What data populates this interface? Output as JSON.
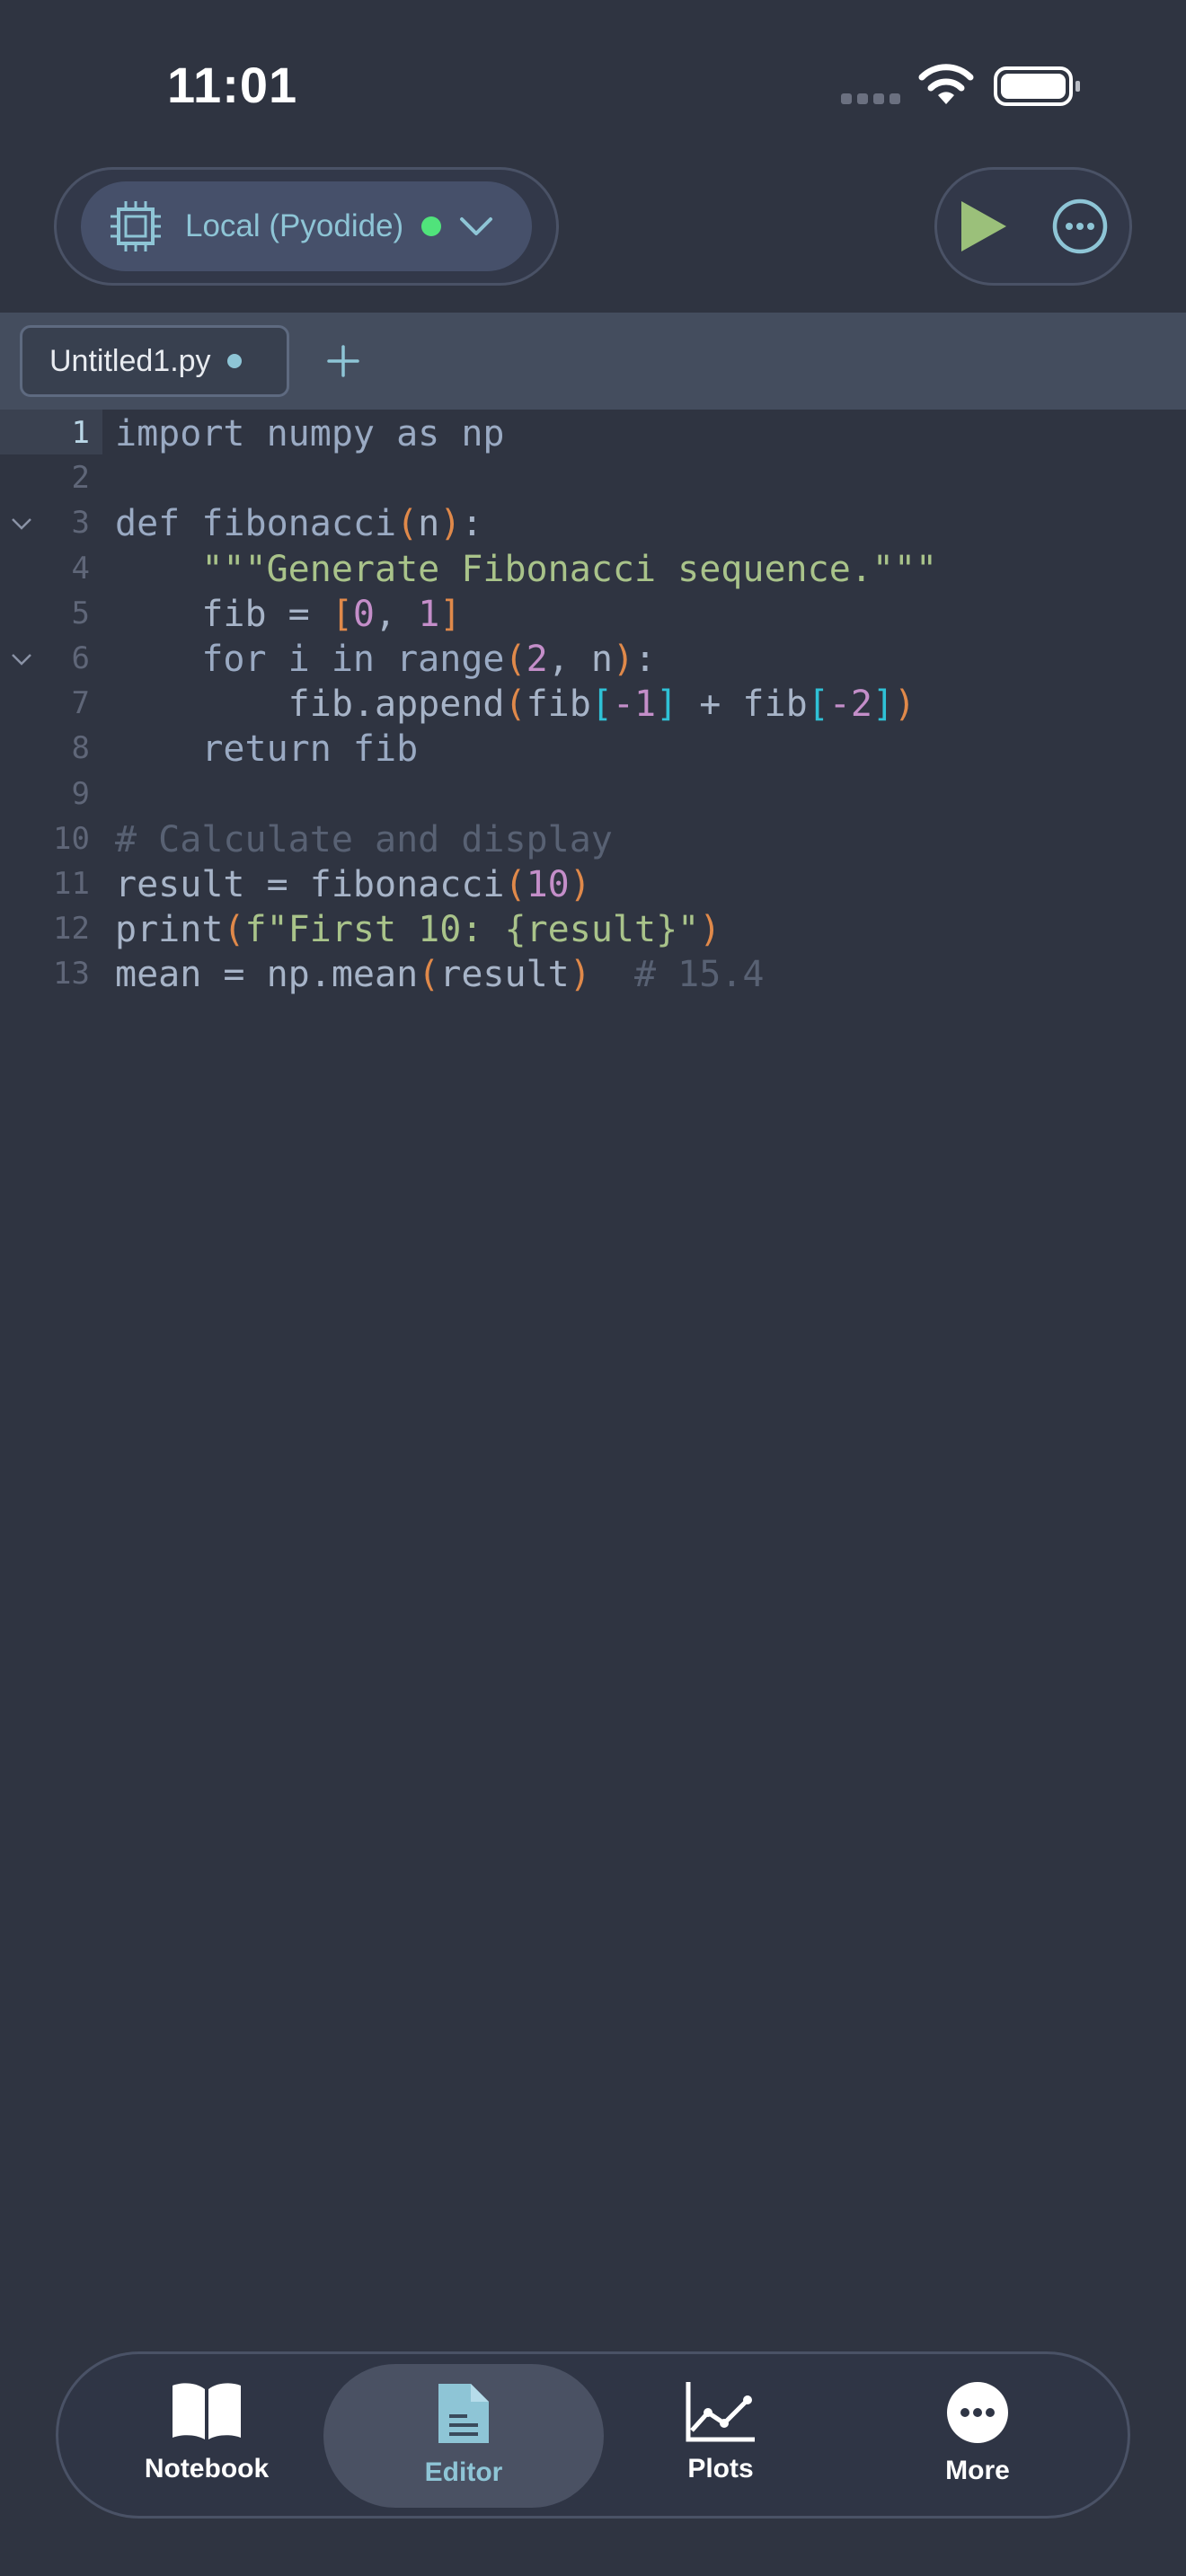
{
  "status_bar": {
    "time": "11:01"
  },
  "kernel": {
    "label": "Local (Pyodide)",
    "status_color": "#50e37b"
  },
  "toolbar": {
    "run_icon": "play-icon",
    "more_icon": "ellipsis-circle-icon"
  },
  "tabs": [
    {
      "label": "Untitled1.py",
      "modified": true
    }
  ],
  "editor": {
    "active_line": 1,
    "lines": [
      {
        "n": "1"
      },
      {
        "n": "2"
      },
      {
        "n": "3"
      },
      {
        "n": "4"
      },
      {
        "n": "5"
      },
      {
        "n": "6"
      },
      {
        "n": "7"
      },
      {
        "n": "8"
      },
      {
        "n": "9"
      },
      {
        "n": "10"
      },
      {
        "n": "11"
      },
      {
        "n": "12"
      },
      {
        "n": "13"
      }
    ],
    "tokens": {
      "l1": "import numpy as np",
      "l3_def": "def fibonacci",
      "l3_arg": "n",
      "l4": "\"\"\"Generate Fibonacci sequence.\"\"\"",
      "l5_a": "fib = ",
      "l5_n0": "0",
      "l5_n1": "1",
      "l6_a": "for i in range",
      "l6_n": "2",
      "l6_b": ", n",
      "l7_a": "fib.append",
      "l7_b": "fib",
      "l7_n1": "-1",
      "l7_c": " + fib",
      "l7_n2": "-2",
      "l8": "return fib",
      "l10": "# Calculate and display",
      "l11_a": "result = fibonacci",
      "l11_n": "10",
      "l12_a": "print",
      "l12_s": "f\"First 10: {result}\"",
      "l13_a": "mean = np.mean",
      "l13_b": "result",
      "l13_c": "# 15.4"
    }
  },
  "nav": {
    "items": [
      {
        "label": "Notebook",
        "icon": "book-icon"
      },
      {
        "label": "Editor",
        "icon": "document-icon",
        "active": true
      },
      {
        "label": "Plots",
        "icon": "chart-icon"
      },
      {
        "label": "More",
        "icon": "more-icon"
      }
    ]
  }
}
